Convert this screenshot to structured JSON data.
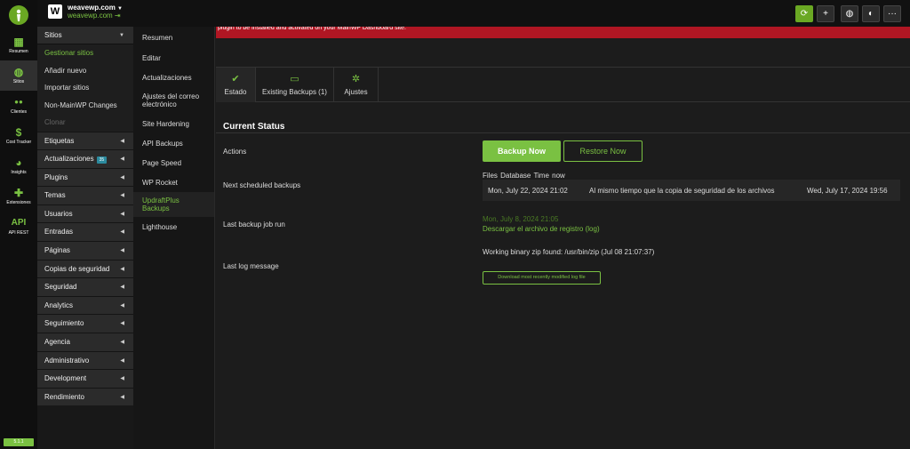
{
  "iconbar": {
    "items": [
      {
        "icon": "grid-icon",
        "glyph": "▦",
        "label": "Resumen"
      },
      {
        "icon": "globe-icon",
        "glyph": "◍",
        "label": "Sitios"
      },
      {
        "icon": "users-icon",
        "glyph": "●●",
        "label": "Clientes"
      },
      {
        "icon": "dollar-icon",
        "glyph": "$",
        "label": "Cost Tracker"
      },
      {
        "icon": "pie-chart-icon",
        "glyph": "◕",
        "label": "Insights"
      },
      {
        "icon": "puzzle-icon",
        "glyph": "✚",
        "label": "Extensiones"
      },
      {
        "icon": "api-icon",
        "glyph": "API",
        "label": "API REST"
      }
    ],
    "version": "5.1.1"
  },
  "topbar": {
    "site_name": "weavewp.com",
    "site_url": "weavewp.com",
    "site_initial": "W"
  },
  "menu1": {
    "header": "Sitios",
    "subitems": [
      "Gestionar sitios",
      "Añadir nuevo",
      "Importar sitios",
      "Non-MainWP Changes",
      "Clonar"
    ],
    "items": [
      "Etiquetas",
      "Actualizaciones",
      "Plugins",
      "Temas",
      "Usuarios",
      "Entradas",
      "Páginas",
      "Copias de seguridad",
      "Seguridad",
      "Analytics",
      "Seguimiento",
      "Agencia",
      "Administrativo",
      "Development",
      "Rendimiento"
    ],
    "updates_badge": "35"
  },
  "menu2": {
    "items": [
      "Resumen",
      "Editar",
      "Actualizaciones",
      "Ajustes del correo electrónico",
      "Site Hardening",
      "API Backups",
      "Page Speed",
      "WP Rocket",
      "UpdraftPlus Backups",
      "Lighthouse"
    ]
  },
  "alert": {
    "text": "plugin to be installed and activated on your MainWP Dashboard site."
  },
  "tabs": [
    {
      "icon": "check-icon",
      "glyph": "✔",
      "label": "Estado"
    },
    {
      "icon": "hdd-icon",
      "glyph": "▭",
      "label": "Existing Backups (1)"
    },
    {
      "icon": "gear-icon",
      "glyph": "✲",
      "label": "Ajustes"
    }
  ],
  "main": {
    "title": "Current Status",
    "labels": {
      "actions": "Actions",
      "next": "Next scheduled backups",
      "last_run": "Last backup job run",
      "last_log": "Last log message"
    },
    "backup_now": "Backup Now",
    "restore_now": "Restore Now",
    "sched_header": "Files Database Time now",
    "sched_files": "Mon, July 22, 2024 21:02",
    "sched_db": "Al mismo tiempo que la copia de seguridad de los archivos",
    "sched_now": "Wed, July 17, 2024 19:56",
    "last_run_date": "Mon, July 8, 2024 21:05",
    "log_link": "Descargar el archivo de registro (log)",
    "zip_message": "Working binary zip found: /usr/bin/zip (Jul 08 21:07:37)",
    "download_button": "Download most recently modified log file"
  },
  "colors": {
    "accent": "#7ac142",
    "alert": "#b01623"
  }
}
